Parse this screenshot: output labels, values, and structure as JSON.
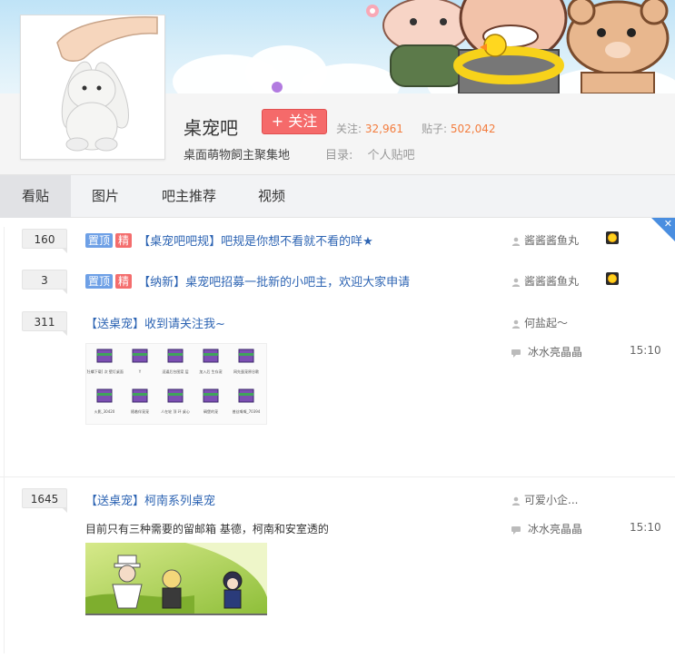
{
  "forum": {
    "name": "桌宠吧",
    "follow_label": "+ 关注",
    "follow_key": "关注:",
    "follow_count": "32,961",
    "posts_key": "贴子:",
    "posts_count": "502,042",
    "slogan": "桌面萌物飼主聚集地",
    "catalog_key": "目录:",
    "catalog_value": "个人贴吧"
  },
  "tabs": [
    {
      "label": "看贴",
      "active": true
    },
    {
      "label": "图片"
    },
    {
      "label": "吧主推荐"
    },
    {
      "label": "视频"
    }
  ],
  "threads": [
    {
      "replies": "160",
      "badges": [
        "置顶",
        "精"
      ],
      "title": "【桌宠吧吧规】吧规是你想不看就不看的咩★",
      "author": "酱酱酱鱼丸"
    },
    {
      "replies": "3",
      "badges": [
        "置顶",
        "精"
      ],
      "title": "【纳新】桌宠吧招募一批新的小吧主，欢迎大家申请",
      "author": "酱酱酱鱼丸"
    },
    {
      "replies": "311",
      "title": "【送桌宠】收到请关注我~",
      "author": "何盐起～",
      "last_reply": "冰水亮晶晶",
      "time": "15:10",
      "thumb_labels": [
        "[牡蠣下载] 次 壁灯桌面",
        "Y",
        "逗逼后台图案 层",
        "加入后 生存宠",
        "网先蛋宠原谷歌",
        "火影_30420",
        "随着伴宠宠",
        "人在轮 顶 环 桌心",
        "碉堡的宠",
        "普丝嘅嘅_70394"
      ]
    },
    {
      "replies": "1645",
      "title": "【送桌宠】柯南系列桌宠",
      "author": "可爱小企...",
      "last_reply": "冰水亮晶晶",
      "time": "15:10",
      "abstract": "目前只有三种需要的留邮箱 基德，柯南和安室透的"
    }
  ],
  "colors": {
    "accent_red": "#f56a6a",
    "link_blue": "#2d64b3",
    "stat_orange": "#f37c3d",
    "badge_top": "#6ea0e6",
    "badge_good": "#f46d6d"
  },
  "icons": [
    "user-icon",
    "reply-icon",
    "level-badge-icon",
    "close-icon"
  ]
}
